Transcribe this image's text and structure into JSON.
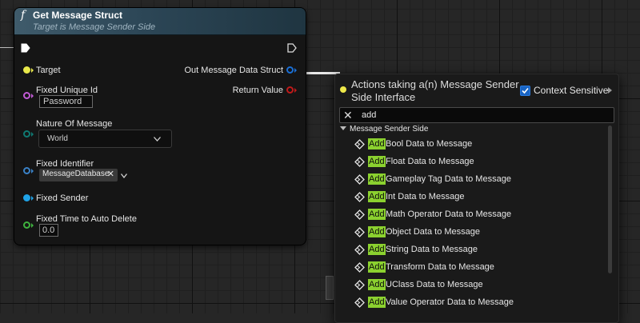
{
  "node": {
    "title": "Get Message Struct",
    "subtitle": "Target is Message Sender Side",
    "pins": {
      "target": "Target",
      "fixed_unique_id": "Fixed Unique Id",
      "fixed_unique_id_value": "Password",
      "nature_of_message": "Nature Of Message",
      "nature_of_message_value": "World",
      "fixed_identifier": "Fixed Identifier",
      "fixed_identifier_value": "MessageDatabase",
      "fixed_sender": "Fixed Sender",
      "fixed_time_to_auto_delete": "Fixed Time to Auto Delete",
      "fixed_time_to_auto_delete_value": "0.0",
      "out_message_data_struct": "Out Message Data Struct",
      "return_value": "Return Value"
    },
    "pin_colors": {
      "target": "#e8e84a",
      "fixed_unique_id": "#c35bd7",
      "nature_of_message": "#0f7a73",
      "fixed_identifier": "#3a82c8",
      "fixed_sender": "#1fa3e8",
      "fixed_time": "#3fb43f",
      "out_struct": "#1a6fd6",
      "return_value": "#c11a1a"
    }
  },
  "action_menu": {
    "title": "Actions taking a(n) Message Sender Side Interface",
    "context_sensitive_label": "Context Sensitive",
    "context_sensitive_checked": true,
    "search_value": "add",
    "category": "Message Sender Side",
    "items": [
      {
        "highlight": "Add",
        "rest": " Bool Data to Message"
      },
      {
        "highlight": "Add",
        "rest": " Float Data to Message"
      },
      {
        "highlight": "Add",
        "rest": " Gameplay Tag Data to Message"
      },
      {
        "highlight": "Add",
        "rest": " Int Data to Message"
      },
      {
        "highlight": "Add",
        "rest": " Math Operator Data to Message"
      },
      {
        "highlight": "Add",
        "rest": " Object Data to Message"
      },
      {
        "highlight": "Add",
        "rest": " String Data to Message"
      },
      {
        "highlight": "Add",
        "rest": " Transform Data to Message"
      },
      {
        "highlight": "Add",
        "rest": " UClass Data to Message"
      },
      {
        "highlight": "Add",
        "rest": " Value Operator Data to Message"
      }
    ]
  }
}
